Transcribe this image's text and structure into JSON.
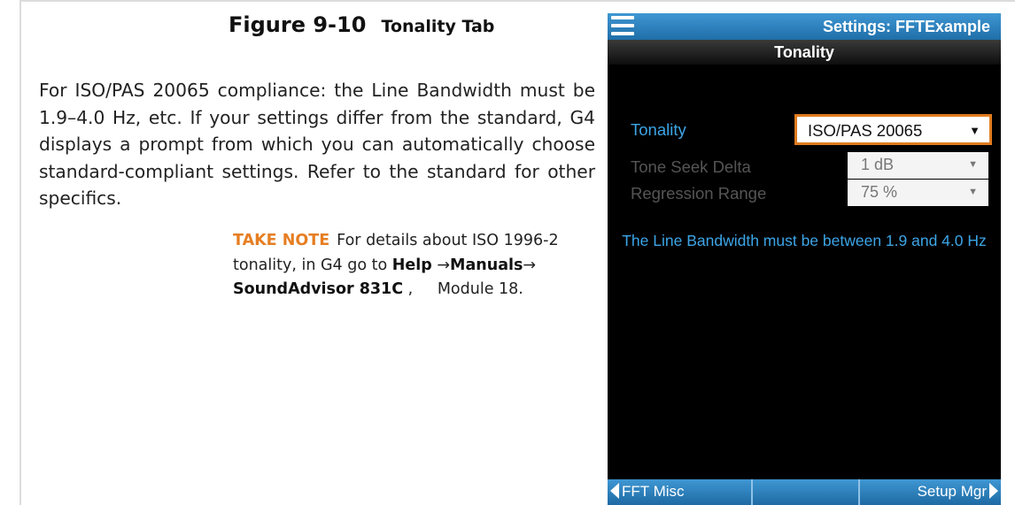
{
  "figure": {
    "number": "Figure 9-10",
    "title": "Tonality Tab"
  },
  "body_text": "For ISO/PAS 20065 compliance: the Line Bandwidth must be 1.9–4.0 Hz, etc. If your settings differ from the standard, G4 displays a prompt from which you can automatically choose standard-compliant settings. Refer to the standard for other specifics.",
  "note": {
    "label": "TAKE NOTE",
    "text": "For details about ISO 1996-2 tonality, in G4 go to",
    "path_help": "Help",
    "arrow": "→",
    "path_manuals": "Manuals",
    "path_device": "SoundAdvisor 831C",
    "comma": ",",
    "module": "Module 18."
  },
  "device": {
    "header_title": "Settings: FFTExample",
    "subtitle": "Tonality",
    "menu_icon": "hamburger-menu-icon",
    "tonality": {
      "label": "Tonality",
      "value": "ISO/PAS 20065",
      "caret": "▼"
    },
    "tone_seek": {
      "label": "Tone Seek Delta",
      "value": "1 dB",
      "caret": "▼"
    },
    "regression": {
      "label": "Regression Range",
      "value": "75 %",
      "caret": "▼"
    },
    "message": "The Line Bandwidth must be between 1.9 and 4.0 Hz",
    "footer": {
      "left": "FFT Misc",
      "right": "Setup Mgr"
    },
    "colors": {
      "header_blue": "#2f86c4",
      "highlight_orange": "#e07b1f",
      "text_blue": "#3ca5e6",
      "take_note_orange": "#e67e22"
    }
  }
}
